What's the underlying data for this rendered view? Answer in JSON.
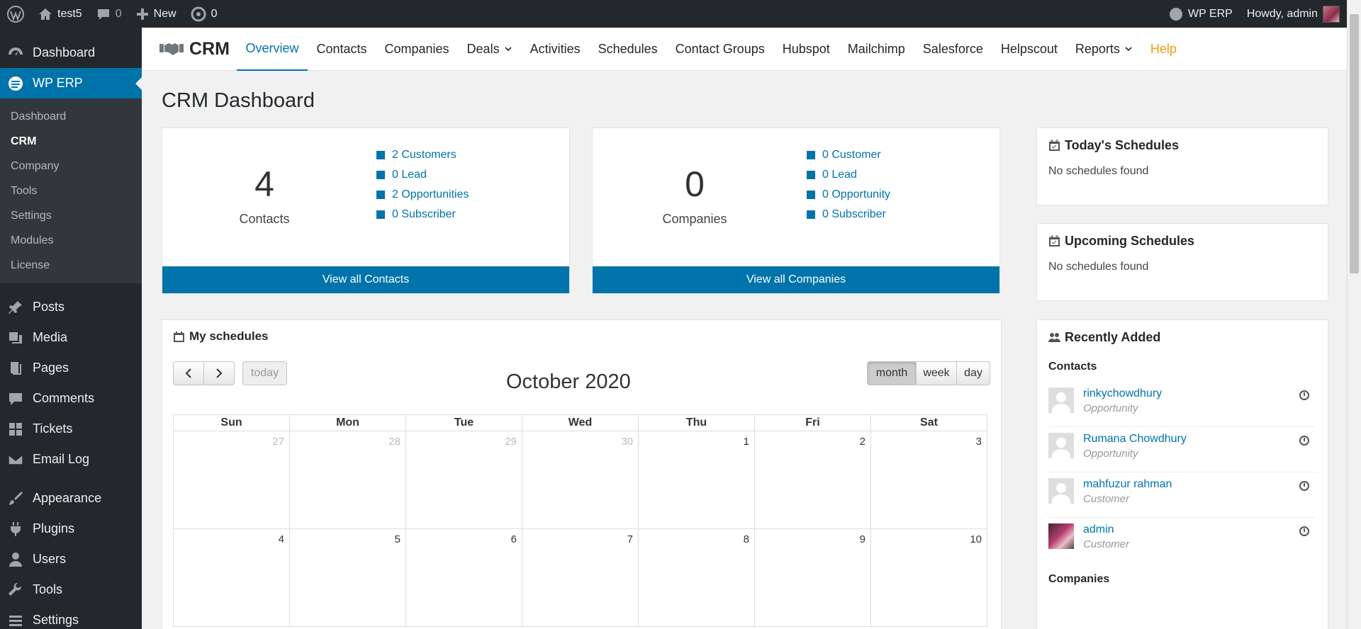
{
  "adminbar": {
    "site": "test5",
    "comments": "0",
    "new": "New",
    "updates": "0",
    "erp": "WP ERP",
    "howdy": "Howdy, admin"
  },
  "sidebar": {
    "dashboard": "Dashboard",
    "wperp": "WP ERP",
    "sub": [
      "Dashboard",
      "CRM",
      "Company",
      "Tools",
      "Settings",
      "Modules",
      "License"
    ],
    "group2": [
      "Posts",
      "Media",
      "Pages",
      "Comments",
      "Tickets",
      "Email Log"
    ],
    "group3": [
      "Appearance",
      "Plugins",
      "Users",
      "Tools",
      "Settings"
    ]
  },
  "topnav": {
    "brand": "CRM",
    "tabs": [
      "Overview",
      "Contacts",
      "Companies",
      "Deals",
      "Activities",
      "Schedules",
      "Contact Groups",
      "Hubspot",
      "Mailchimp",
      "Salesforce",
      "Helpscout",
      "Reports",
      "Help"
    ]
  },
  "page": {
    "title": "CRM Dashboard"
  },
  "contacts_box": {
    "count": "4",
    "label": "Contacts",
    "items": [
      "2 Customers",
      "0 Lead",
      "2 Opportunities",
      "0 Subscriber"
    ],
    "footer": "View all Contacts"
  },
  "companies_box": {
    "count": "0",
    "label": "Companies",
    "items": [
      "0 Customer",
      "0 Lead",
      "0 Opportunity",
      "0 Subscriber"
    ],
    "footer": "View all Companies"
  },
  "schedules": {
    "title": "My schedules",
    "today": "today",
    "month_label": "October 2020",
    "views": [
      "month",
      "week",
      "day"
    ],
    "days": [
      "Sun",
      "Mon",
      "Tue",
      "Wed",
      "Thu",
      "Fri",
      "Sat"
    ],
    "week1": [
      "27",
      "28",
      "29",
      "30",
      "1",
      "2",
      "3"
    ],
    "week2": [
      "4",
      "5",
      "6",
      "7",
      "8",
      "9",
      "10"
    ]
  },
  "todays": {
    "title": "Today's Schedules",
    "empty": "No schedules found"
  },
  "upcoming": {
    "title": "Upcoming Schedules",
    "empty": "No schedules found"
  },
  "recent": {
    "title": "Recently Added",
    "contacts_heading": "Contacts",
    "companies_heading": "Companies",
    "contacts": [
      {
        "name": "rinkychowdhury",
        "type": "Opportunity"
      },
      {
        "name": "Rumana Chowdhury",
        "type": "Opportunity"
      },
      {
        "name": "mahfuzur rahman",
        "type": "Customer"
      },
      {
        "name": "admin",
        "type": "Customer"
      }
    ]
  },
  "colors": {
    "accent": "#0073aa",
    "help": "#f39c12",
    "sidebar": "#23282d"
  }
}
